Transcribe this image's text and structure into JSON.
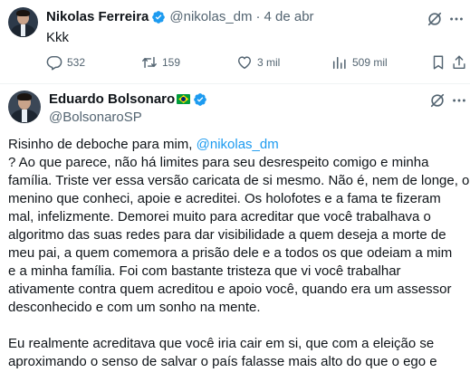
{
  "tweet1": {
    "display_name": "Nikolas Ferreira",
    "handle": "@nikolas_dm",
    "separator": "·",
    "date": "4 de abr",
    "text": "Kkk",
    "replies": "532",
    "retweets": "159",
    "likes": "3 mil",
    "views": "509 mil",
    "icons": [
      "verified-badge-icon",
      "grok-icon",
      "more-icon",
      "reply-icon",
      "retweet-icon",
      "like-icon",
      "views-icon",
      "bookmark-icon",
      "share-icon"
    ]
  },
  "tweet2": {
    "display_name": "Eduardo Bolsonaro",
    "handle": "@BolsonaroSP",
    "flag": "brazil-flag-emoji",
    "lines": [
      {
        "pre": "Risinho de deboche para mim, ",
        "mention": "@nikolas_dm"
      },
      {
        "pre": "? Ao que parece, não há limites para seu desrespeito comigo e minha",
        "mention": ""
      },
      {
        "pre": "família. Triste ver essa versão caricata de si mesmo. Não é, nem de longe, o",
        "mention": ""
      },
      {
        "pre": "menino que conheci, apoie e acreditei. Os holofotes e a fama te fizeram",
        "mention": ""
      },
      {
        "pre": "mal, infelizmente. Demorei muito para acreditar que você trabalhava o",
        "mention": ""
      },
      {
        "pre": "algoritmo das suas redes para dar visibilidade a quem deseja a morte de",
        "mention": ""
      },
      {
        "pre": "meu pai, a quem comemora a prisão dele e a todos os que odeiam a mim",
        "mention": ""
      },
      {
        "pre": "e a minha família. Foi com bastante tristeza que vi você trabalhar",
        "mention": ""
      },
      {
        "pre": "ativamente contra quem acreditou e apoio você, quando era um assessor",
        "mention": ""
      },
      {
        "pre": "desconhecido e com um sonho na mente.",
        "mention": ""
      }
    ],
    "lines2": [
      {
        "pre": "Eu realmente acreditava que você iria cair em si, que com a eleição se",
        "mention": ""
      },
      {
        "pre": "aproximando o senso de salvar o país falasse mais alto do que o ego e",
        "mention": ""
      }
    ]
  },
  "colors": {
    "text": "#0f1419",
    "secondary": "#536471",
    "link": "#1d9bf0",
    "verified": "#1d9bf0",
    "divider": "#eff3f4"
  }
}
